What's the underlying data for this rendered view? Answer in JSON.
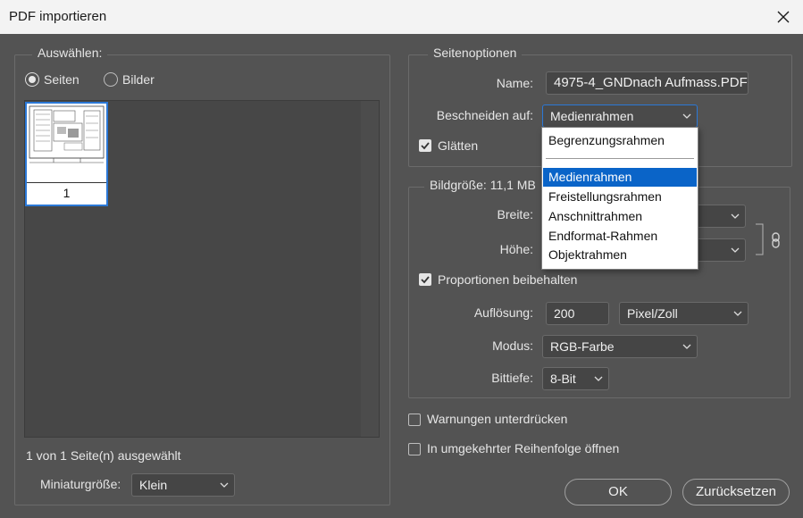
{
  "window": {
    "title": "PDF importieren"
  },
  "select_group": {
    "legend": "Auswählen:",
    "radio_pages": "Seiten",
    "radio_images": "Bilder",
    "thumbnail_page": "1",
    "selection_status": "1 von 1 Seite(n) ausgewählt",
    "thumb_size_label": "Miniaturgröße:",
    "thumb_size_value": "Klein"
  },
  "page_options": {
    "legend": "Seitenoptionen",
    "name_label": "Name:",
    "name_value": "4975-4_GNDnach Aufmass.PDF",
    "crop_label": "Beschneiden auf:",
    "crop_value": "Medienrahmen",
    "smooth_label": "Glätten",
    "smooth_checked": true
  },
  "crop_dropdown": {
    "items": [
      "Begrenzungsrahmen",
      "Medienrahmen",
      "Freistellungsrahmen",
      "Anschnittrahmen",
      "Endformat-Rahmen",
      "Objektrahmen"
    ],
    "selected": "Medienrahmen"
  },
  "image_size": {
    "legend": "Bildgröße: 11,1 MB",
    "width_label": "Breite:",
    "height_label": "Höhe:",
    "proportions_label": "Proportionen beibehalten",
    "proportions_checked": true,
    "resolution_label": "Auflösung:",
    "resolution_value": "200",
    "resolution_unit": "Pixel/Zoll",
    "mode_label": "Modus:",
    "mode_value": "RGB-Farbe",
    "depth_label": "Bittiefe:",
    "depth_value": "8-Bit"
  },
  "options": {
    "suppress_warnings": "Warnungen unterdrücken",
    "reverse_order": "In umgekehrter Reihenfolge öffnen"
  },
  "buttons": {
    "ok": "OK",
    "reset": "Zurücksetzen"
  },
  "icons": [
    "close-icon",
    "chevron-down-icon",
    "checkmark-icon",
    "link-icon"
  ],
  "colors": {
    "background": "#535353",
    "titlebar": "#f3f3f3",
    "highlight": "#0a64c8",
    "field": "#454545"
  }
}
